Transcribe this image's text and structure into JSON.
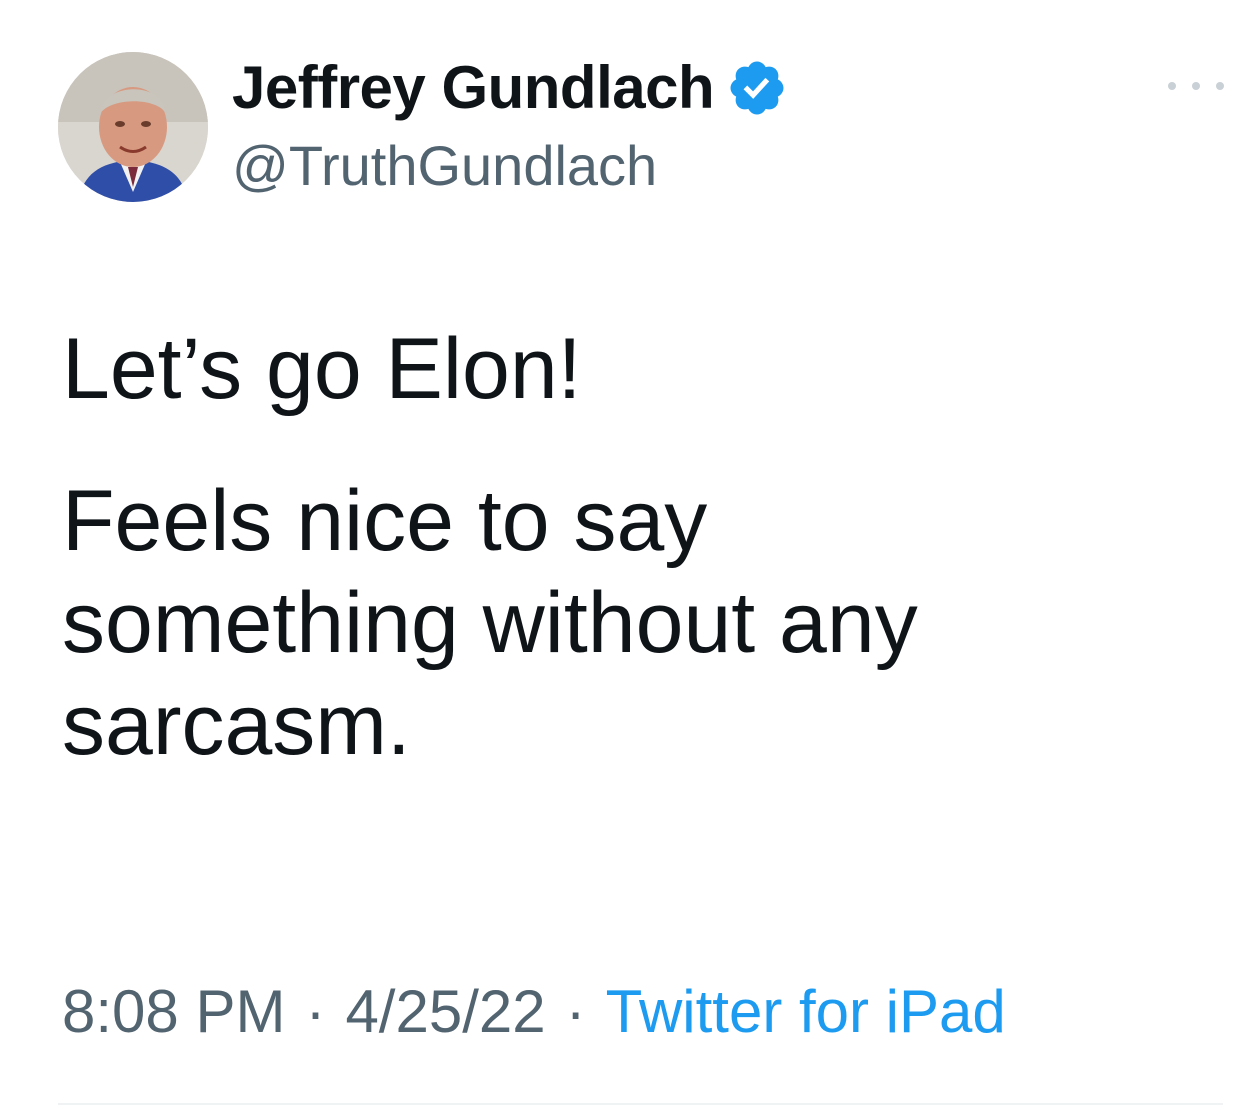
{
  "author": {
    "display_name": "Jeffrey Gundlach",
    "handle": "@TruthGundlach",
    "verified": true
  },
  "tweet": {
    "line1": "Let’s go Elon!",
    "line2": "Feels nice to say\nsomething without any\nsarcasm."
  },
  "meta": {
    "time": "8:08 PM",
    "separator": "·",
    "date": "4/25/22",
    "source": "Twitter for iPad"
  },
  "colors": {
    "text": "#0f1419",
    "secondary": "#536471",
    "accent": "#1d9bf0",
    "verified_badge": "#1d9bf0"
  },
  "icons": {
    "verified": "verified-badge-icon",
    "more": "more-options-icon"
  }
}
